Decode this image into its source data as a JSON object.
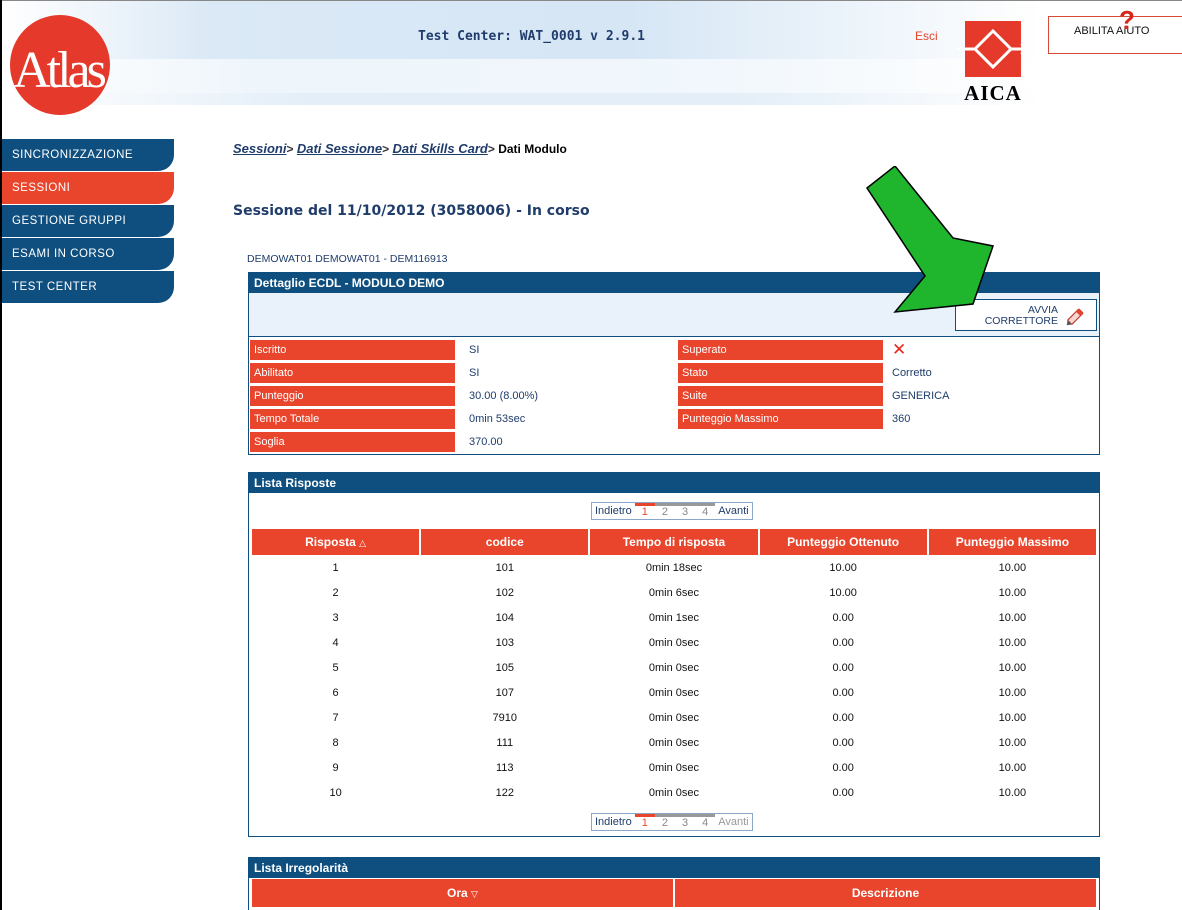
{
  "header": {
    "app_title": "Test Center: WAT_0001 v 2.9.1",
    "logout_label": "Esci",
    "help_label": "ABILITA AIUTO",
    "help_icon": "question-icon",
    "logo_left": "Atlas",
    "logo_right": "AICA"
  },
  "sidebar": {
    "items": [
      {
        "label": "SINCRONIZZAZIONE",
        "active": false
      },
      {
        "label": "SESSIONI",
        "active": true
      },
      {
        "label": "GESTIONE GRUPPI",
        "active": false
      },
      {
        "label": "ESAMI IN CORSO",
        "active": false
      },
      {
        "label": "TEST CENTER",
        "active": false
      }
    ]
  },
  "breadcrumb": {
    "items": [
      "Sessioni",
      "Dati Sessione",
      "Dati Skills Card"
    ],
    "separator": ">",
    "current": "Dati Modulo"
  },
  "session_title": "Sessione del 11/10/2012 (3058006) - In corso",
  "subject_line": "DEMOWAT01 DEMOWAT01 - DEM116913",
  "detail": {
    "title": "Dettaglio ECDL - MODULO DEMO",
    "avvia_label_1": "AVVIA",
    "avvia_label_2": "CORRETTORE",
    "fields_left": [
      {
        "label": "Iscritto",
        "value": "SI"
      },
      {
        "label": "Abilitato",
        "value": "SI"
      },
      {
        "label": "Punteggio",
        "value": "30.00 (8.00%)"
      },
      {
        "label": "Tempo Totale",
        "value": "0min 53sec"
      },
      {
        "label": "Soglia",
        "value": "370.00"
      }
    ],
    "fields_right": [
      {
        "label": "Superato",
        "value": "✕"
      },
      {
        "label": "Stato",
        "value": "Corretto"
      },
      {
        "label": "Suite",
        "value": "GENERICA"
      },
      {
        "label": "Punteggio Massimo",
        "value": "360"
      }
    ]
  },
  "risposte": {
    "title": "Lista Risposte",
    "pager_top": {
      "prev": "Indietro",
      "pages": [
        "1",
        "2",
        "3",
        "4"
      ],
      "next": "Avanti"
    },
    "pager_bottom": {
      "prev": "Indietro",
      "pages": [
        "1",
        "2",
        "3",
        "4"
      ],
      "next": "Avanti"
    },
    "columns": [
      "Risposta",
      "codice",
      "Tempo di risposta",
      "Punteggio Ottenuto",
      "Punteggio Massimo"
    ],
    "rows": [
      [
        "1",
        "101",
        "0min 18sec",
        "10.00",
        "10.00"
      ],
      [
        "2",
        "102",
        "0min 6sec",
        "10.00",
        "10.00"
      ],
      [
        "3",
        "104",
        "0min 1sec",
        "0.00",
        "10.00"
      ],
      [
        "4",
        "103",
        "0min 0sec",
        "0.00",
        "10.00"
      ],
      [
        "5",
        "105",
        "0min 0sec",
        "0.00",
        "10.00"
      ],
      [
        "6",
        "107",
        "0min 0sec",
        "0.00",
        "10.00"
      ],
      [
        "7",
        "7910",
        "0min 0sec",
        "0.00",
        "10.00"
      ],
      [
        "8",
        "111",
        "0min 0sec",
        "0.00",
        "10.00"
      ],
      [
        "9",
        "113",
        "0min 0sec",
        "0.00",
        "10.00"
      ],
      [
        "10",
        "122",
        "0min 0sec",
        "0.00",
        "10.00"
      ]
    ]
  },
  "irregolarita": {
    "title": "Lista Irregolarità",
    "columns": [
      "Ora",
      "Descrizione"
    ]
  },
  "colors": {
    "navy": "#0f4f7f",
    "accent_red": "#e8452c",
    "arrow_green": "#1fb52c"
  }
}
